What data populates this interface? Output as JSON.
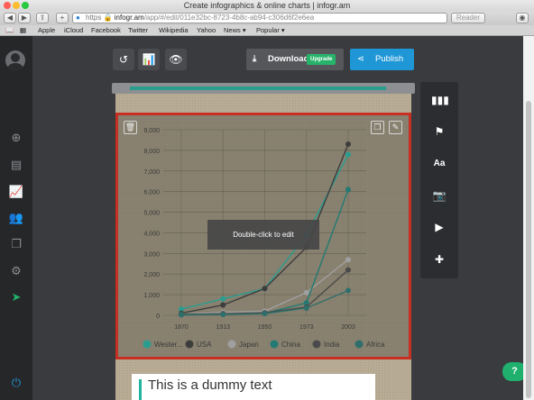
{
  "window": {
    "title": "Create infographics & online charts | infogr.am",
    "url_scheme": "https",
    "url_host": "infogr.am",
    "url_path": "/app/#/edit/011e32bc-8723-4b8c-ab94-c306d6f2e6ea",
    "reader_label": "Reader"
  },
  "bookmarks": [
    "Apple",
    "iCloud",
    "Facebook",
    "Twitter",
    "Wikipedia",
    "Yahoo",
    "News ▾",
    "Popular ▾"
  ],
  "editor": {
    "download_label": "Download",
    "upgrade_label": "Upgrade",
    "publish_label": "Publish",
    "hint": "Double-click to edit",
    "text_block": "This is a dummy text"
  },
  "chart_data": {
    "type": "line",
    "x": [
      1870,
      1913,
      1950,
      1973,
      2003
    ],
    "ylim": [
      0,
      9000
    ],
    "yticks": [
      "0",
      "1,000",
      "2,000",
      "3,000",
      "4,000",
      "5,000",
      "6,000",
      "7,000",
      "8,000",
      "9,000"
    ],
    "xticks": [
      "1870",
      "1913",
      "1950",
      "1973",
      "2003"
    ],
    "legend_position": "bottom",
    "series": [
      {
        "name": "Wester...",
        "color": "#2a9d8f",
        "values": [
          300,
          800,
          1300,
          3900,
          7800
        ]
      },
      {
        "name": "USA",
        "color": "#3d3d3d",
        "values": [
          100,
          500,
          1300,
          3300,
          8300
        ]
      },
      {
        "name": "Japan",
        "color": "#a0a0a0",
        "values": [
          50,
          150,
          200,
          1100,
          2700
        ]
      },
      {
        "name": "China",
        "color": "#227a72",
        "values": [
          50,
          60,
          100,
          600,
          6100
        ]
      },
      {
        "name": "India",
        "color": "#4a4a4a",
        "values": [
          40,
          80,
          120,
          400,
          2200
        ]
      },
      {
        "name": "Africa",
        "color": "#2f6f6b",
        "values": [
          20,
          40,
          80,
          350,
          1200
        ]
      }
    ]
  },
  "sidebar": {
    "icons": [
      "avatar",
      "add-icon",
      "inbox-icon",
      "chart-icon",
      "users-icon",
      "copy-icon",
      "gear-icon",
      "rocket-icon",
      "power-icon"
    ]
  },
  "right_panel": {
    "icons": [
      "bar-chart-icon",
      "map-icon",
      "text-icon",
      "camera-icon",
      "video-icon",
      "puzzle-icon"
    ],
    "text_label": "Aa"
  },
  "help_label": "?"
}
